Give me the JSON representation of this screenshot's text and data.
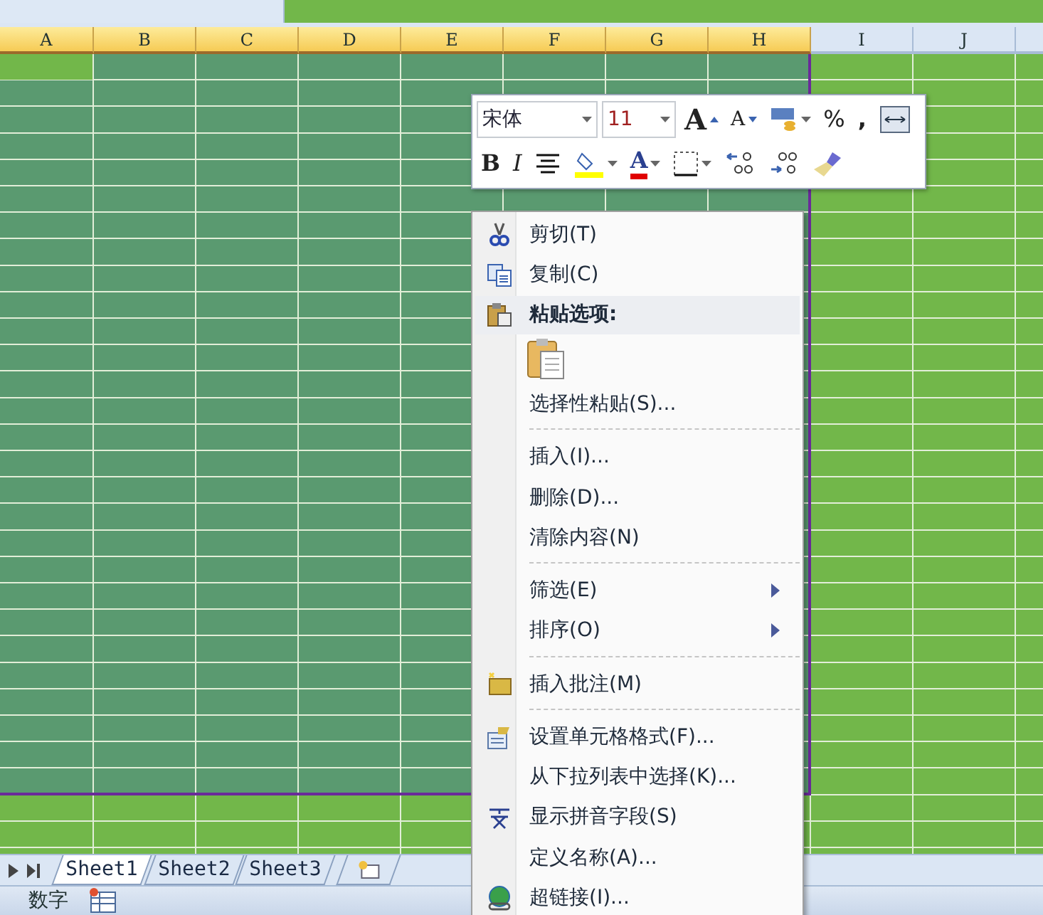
{
  "columns": [
    {
      "label": "A",
      "selected": true
    },
    {
      "label": "B",
      "selected": true
    },
    {
      "label": "C",
      "selected": true
    },
    {
      "label": "D",
      "selected": true
    },
    {
      "label": "E",
      "selected": true
    },
    {
      "label": "F",
      "selected": true
    },
    {
      "label": "G",
      "selected": true
    },
    {
      "label": "H",
      "selected": true
    },
    {
      "label": "I",
      "selected": false
    },
    {
      "label": "J",
      "selected": false
    },
    {
      "selected": false
    }
  ],
  "mini_toolbar": {
    "font": "宋体",
    "size": "11",
    "row1": [
      {
        "kind": "grow",
        "label": "A"
      },
      {
        "kind": "shrink",
        "label": "A"
      },
      {
        "kind": "currency"
      },
      {
        "kind": "percent",
        "label": "%"
      },
      {
        "kind": "comma",
        "label": ","
      },
      {
        "kind": "merge"
      }
    ],
    "row2": [
      {
        "kind": "bold",
        "label": "B"
      },
      {
        "kind": "italic",
        "label": "I"
      },
      {
        "kind": "center"
      },
      {
        "kind": "fill"
      },
      {
        "kind": "fontcolor",
        "label": "A"
      },
      {
        "kind": "border"
      },
      {
        "kind": "incdec"
      },
      {
        "kind": "decdec"
      },
      {
        "kind": "painter"
      }
    ]
  },
  "context_menu": [
    {
      "kind": "item",
      "label": "剪切(T)",
      "submenu": false
    },
    {
      "kind": "item",
      "label": "复制(C)",
      "submenu": false
    },
    {
      "kind": "header",
      "label": "粘贴选项:"
    },
    {
      "kind": "paste"
    },
    {
      "kind": "item",
      "label": "选择性粘贴(S)...",
      "submenu": false
    },
    {
      "kind": "separator"
    },
    {
      "kind": "item",
      "label": "插入(I)...",
      "submenu": false
    },
    {
      "kind": "item",
      "label": "删除(D)...",
      "submenu": false
    },
    {
      "kind": "item",
      "label": "清除内容(N)",
      "submenu": false
    },
    {
      "kind": "separator"
    },
    {
      "kind": "item",
      "label": "筛选(E)",
      "submenu": true
    },
    {
      "kind": "item",
      "label": "排序(O)",
      "submenu": true
    },
    {
      "kind": "separator"
    },
    {
      "kind": "item",
      "label": "插入批注(M)",
      "submenu": false
    },
    {
      "kind": "separator"
    },
    {
      "kind": "item",
      "label": "设置单元格格式(F)...",
      "submenu": false
    },
    {
      "kind": "item",
      "label": "从下拉列表中选择(K)...",
      "submenu": false
    },
    {
      "kind": "item",
      "label": "显示拼音字段(S)",
      "submenu": false
    },
    {
      "kind": "item",
      "label": "定义名称(A)...",
      "submenu": false
    },
    {
      "kind": "item",
      "label": "超链接(I)...",
      "submenu": false
    }
  ],
  "sheet_tabs": [
    {
      "label": "Sheet1",
      "selected": true
    },
    {
      "label": "Sheet2",
      "selected": false
    },
    {
      "label": "Sheet3",
      "selected": false
    }
  ],
  "status_bar": {
    "mode": "数字"
  }
}
